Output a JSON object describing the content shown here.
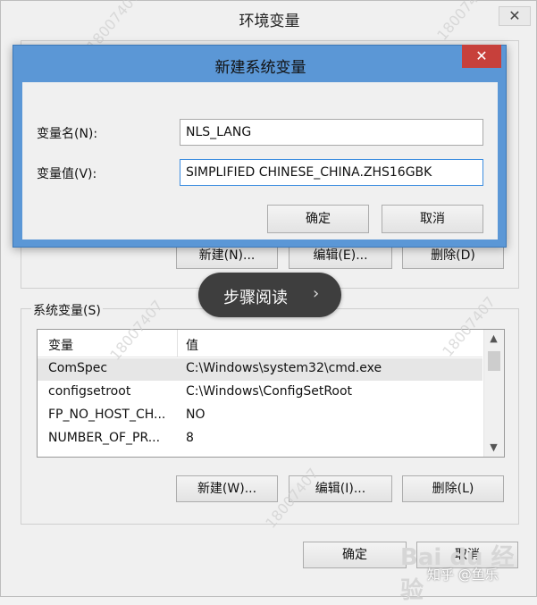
{
  "outer": {
    "title": "环境变量",
    "close_glyph": "✕",
    "user_buttons": {
      "new": "新建(N)...",
      "edit": "编辑(E)...",
      "delete": "删除(D)"
    },
    "sys_group_label": "系统变量(S)",
    "sys_table": {
      "columns": [
        "变量",
        "值"
      ],
      "rows": [
        {
          "name": "ComSpec",
          "value": "C:\\Windows\\system32\\cmd.exe",
          "selected": true
        },
        {
          "name": "configsetroot",
          "value": "C:\\Windows\\ConfigSetRoot",
          "selected": false
        },
        {
          "name": "FP_NO_HOST_CH...",
          "value": "NO",
          "selected": false
        },
        {
          "name": "NUMBER_OF_PR...",
          "value": "8",
          "selected": false
        }
      ],
      "scroll_up_icon": "▲",
      "scroll_down_icon": "▼"
    },
    "sys_buttons": {
      "new": "新建(W)...",
      "edit": "编辑(I)...",
      "delete": "删除(L)"
    },
    "ok": "确定",
    "cancel": "取消"
  },
  "modal": {
    "title": "新建系统变量",
    "close_glyph": "✕",
    "name_label": "变量名(N):",
    "name_value": "NLS_LANG",
    "value_label": "变量值(V):",
    "value_value": "SIMPLIFIED CHINESE_CHINA.ZHS16GBK",
    "ok": "确定",
    "cancel": "取消"
  },
  "overlay": {
    "step_read": "步骤阅读",
    "step_arrow": "›",
    "watermark": "18007407",
    "baidu": "Bai du 经验",
    "zhihu": "知乎 @鱼乐"
  },
  "colors": {
    "modal_frame": "#5b97d6",
    "close_red": "#c7403b",
    "dialog_bg": "#f0f0f0"
  }
}
